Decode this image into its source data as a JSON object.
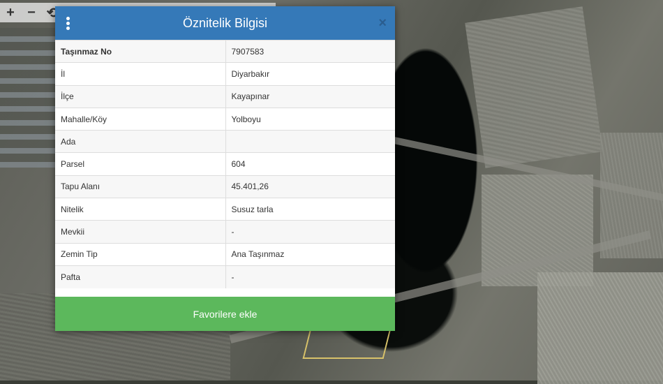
{
  "map": {
    "controls": [
      "+",
      "−",
      "⟲"
    ]
  },
  "modal": {
    "title": "Öznitelik Bilgisi",
    "close_label": "×",
    "rows": [
      {
        "key": "Taşınmaz No",
        "value": "7907583"
      },
      {
        "key": "İl",
        "value": "Diyarbakır"
      },
      {
        "key": "İlçe",
        "value": "Kayapınar"
      },
      {
        "key": "Mahalle/Köy",
        "value": "Yolboyu"
      },
      {
        "key": "Ada",
        "value": ""
      },
      {
        "key": "Parsel",
        "value": "604"
      },
      {
        "key": "Tapu Alanı",
        "value": "45.401,26"
      },
      {
        "key": "Nitelik",
        "value": "Susuz tarla"
      },
      {
        "key": "Mevkii",
        "value": "-"
      },
      {
        "key": "Zemin Tip",
        "value": "Ana Taşınmaz"
      },
      {
        "key": "Pafta",
        "value": "-"
      }
    ],
    "favorite_button": "Favorilere ekle"
  },
  "colors": {
    "header": "#3579b8",
    "favorite_button": "#5cb85c",
    "parcel_outline": "#d8c26a"
  }
}
